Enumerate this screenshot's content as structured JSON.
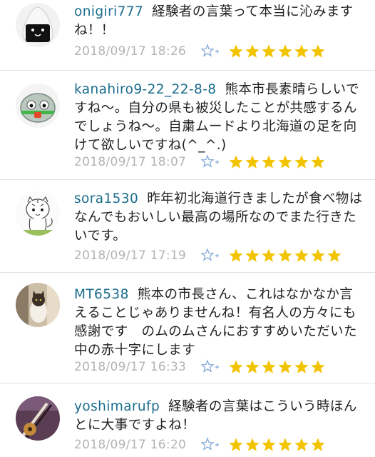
{
  "comments": [
    {
      "username": "onigiri777",
      "text": "経験者の言葉って本当に沁みますね！！",
      "date": "2018/09/17 18:26",
      "avatar_icon": "onigiri-avatar-icon",
      "stars": 6
    },
    {
      "username": "kanahiro9-22_22-8-8",
      "text": "熊本市長素晴らしいですね〜。自分の県も被災したことが共感するんでしょうね〜。自粛ムードより北海道の足を向けて欲しいですね(^_^.)",
      "date": "2018/09/17 18:07",
      "avatar_icon": "green-ball-avatar-icon",
      "stars": 6
    },
    {
      "username": "sora1530",
      "text": "昨年初北海道行きましたが食べ物はなんでもおいしい最高の場所なのでまた行きたいです。",
      "date": "2018/09/17 17:19",
      "avatar_icon": "tiger-avatar-icon",
      "stars": 7
    },
    {
      "username": "MT6538",
      "text": "熊本の市長さん、これはなかなか言えることじゃありませんね！有名人の方々にも感謝です　のムのムさんにおすすめいただいた中の赤十字にします",
      "date": "2018/09/17 16:33",
      "avatar_icon": "cat-photo-avatar-icon",
      "stars": 6
    },
    {
      "username": "yoshimarufp",
      "text": "経験者の言葉はこういう時ほんとに大事ですよね！",
      "date": "2018/09/17 16:20",
      "avatar_icon": "guitar-photo-avatar-icon",
      "stars": 6
    }
  ],
  "colors": {
    "username": "#1a6c8c",
    "star": "#f2c400",
    "date": "#b3b3b3",
    "fav_icon": "#7ea7d8"
  }
}
